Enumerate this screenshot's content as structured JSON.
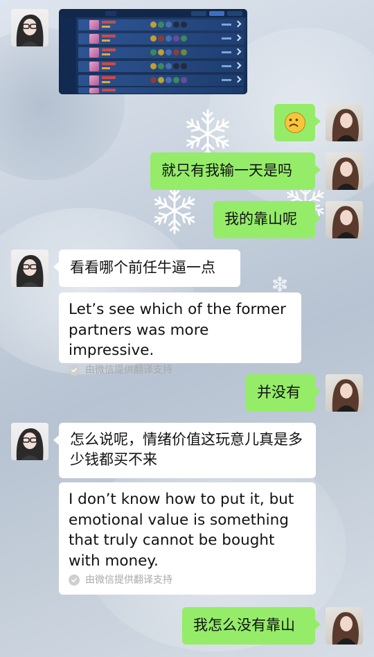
{
  "conversation": {
    "screenshot_icon": "game-match-history-screenshot",
    "messages": [
      {
        "from": "her",
        "type": "image"
      },
      {
        "from": "me",
        "emoji": "☹",
        "emoji_icon": "frown-emoji-icon"
      },
      {
        "from": "me",
        "text": "就只有我输一天是吗"
      },
      {
        "from": "me",
        "text": "我的靠山呢"
      },
      {
        "from": "her",
        "text": "看看哪个前任牛逼一点",
        "translation": "Let’s see which of the former partners was more impressive.",
        "translation_note": "由微信提供翻译支持"
      },
      {
        "from": "me",
        "text": "并没有"
      },
      {
        "from": "her",
        "text": "怎么说呢，情绪价值这玩意儿真是多少钱都买不来",
        "translation": "I don’t know how to put it, but emotional value is something that truly cannot be bought with money.",
        "translation_note": "由微信提供翻译支持"
      },
      {
        "from": "me",
        "text": "我怎么没有靠山"
      }
    ]
  },
  "colors": {
    "sent_bubble": "#95ec69",
    "received_bubble": "#ffffff",
    "note_text": "#a9a9a9"
  }
}
